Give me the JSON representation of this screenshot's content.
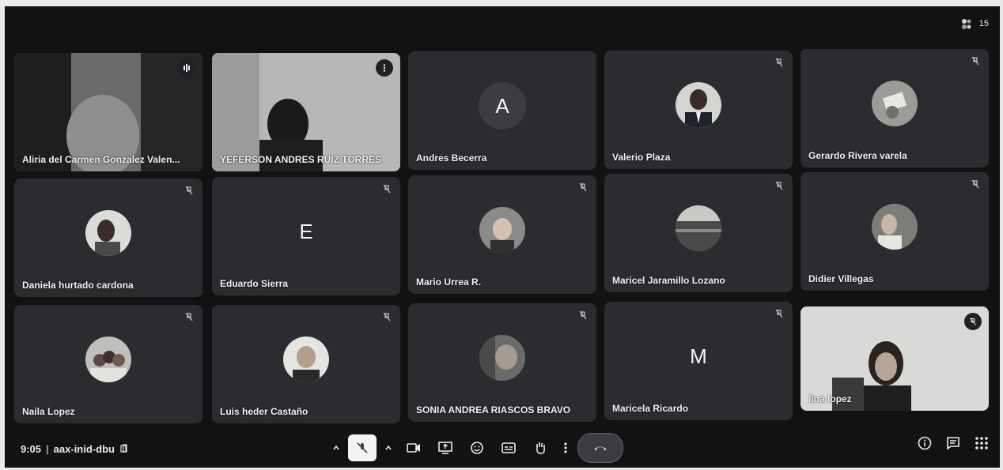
{
  "header": {
    "participant_count": "15"
  },
  "participants": [
    {
      "name": "Aliria del Carmen Gonzalez Valen...",
      "tile": "video-face",
      "speaking": true
    },
    {
      "name": "YEFERSON ANDRES RUIZ TORRES",
      "tile": "video-person"
    },
    {
      "name": "Andres Becerra",
      "initial": "A"
    },
    {
      "name": "Valerio Plaza",
      "tile": "photo-man"
    },
    {
      "name": "Gerardo Rivera varela",
      "tile": "photo-book"
    },
    {
      "name": "Daniela hurtado cardona",
      "tile": "photo-woman"
    },
    {
      "name": "Eduardo Sierra",
      "initial": "E"
    },
    {
      "name": "Mario Urrea R.",
      "tile": "photo-man2"
    },
    {
      "name": "Maricel Jaramillo Lozano",
      "tile": "photo-field"
    },
    {
      "name": "Didier Villegas",
      "tile": "photo-man3"
    },
    {
      "name": "Naila Lopez",
      "tile": "photo-group"
    },
    {
      "name": "Luis heder Castaño",
      "tile": "photo-man4"
    },
    {
      "name": "SONIA ANDREA RIASCOS BRAVO",
      "tile": "photo-woman2"
    },
    {
      "name": "Maricela Ricardo",
      "initial": "M"
    },
    {
      "name": "lina lopez",
      "tile": "video-woman"
    }
  ],
  "footer": {
    "time": "9:05",
    "separator": "|",
    "meeting_code": "aax-inid-dbu"
  },
  "icons": {
    "participants": "people-icon",
    "mic": "mic-off-icon",
    "camera": "camera-icon",
    "present": "present-icon",
    "reactions": "emoji-icon",
    "captions": "captions-icon",
    "hand": "raise-hand-icon",
    "more": "more-vert-icon",
    "leave": "call-end-icon",
    "info": "info-icon",
    "chat": "chat-icon",
    "activities": "apps-icon"
  }
}
